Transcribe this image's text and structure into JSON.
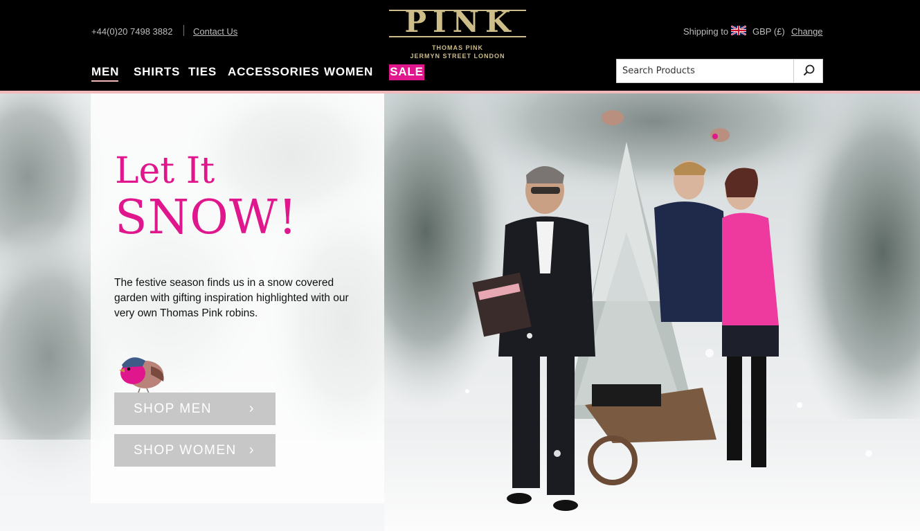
{
  "header": {
    "phone": "+44(0)20 7498 3882",
    "contact_label": "Contact Us",
    "logo": {
      "word": "PINK",
      "line1": "THOMAS PINK",
      "line2": "JERMYN STREET LONDON"
    },
    "shipping_label": "Shipping to",
    "currency": "GBP (£)",
    "change_label": "Change"
  },
  "nav": {
    "items": [
      {
        "label": "MEN"
      },
      {
        "label": "SHIRTS"
      },
      {
        "label": "TIES"
      },
      {
        "label": "ACCESSORIES"
      },
      {
        "label": "WOMEN"
      },
      {
        "label": "SALE"
      }
    ],
    "active": "MEN"
  },
  "search": {
    "placeholder": "Search Products",
    "value": ""
  },
  "hero": {
    "headline_line1": "Let It",
    "headline_line2": "SNOW!",
    "body": "The festive season finds us in a snow covered garden with gifting inspiration highlighted with our very own Thomas Pink robins.",
    "buttons": [
      {
        "label": "SHOP MEN",
        "chevron": "›"
      },
      {
        "label": "SHOP WOMEN",
        "chevron": "›"
      }
    ]
  },
  "colors": {
    "brand_pink": "#e0168c",
    "gold": "#cdbd88",
    "header_bg": "#000000",
    "accent_rule": "#f2b9bd",
    "cta_bg": "#c7c7c7"
  },
  "icons": {
    "search": "magnifier-icon",
    "flag": "uk-flag-icon",
    "chevron": "chevron-right-icon",
    "robin": "robin-illustration"
  }
}
